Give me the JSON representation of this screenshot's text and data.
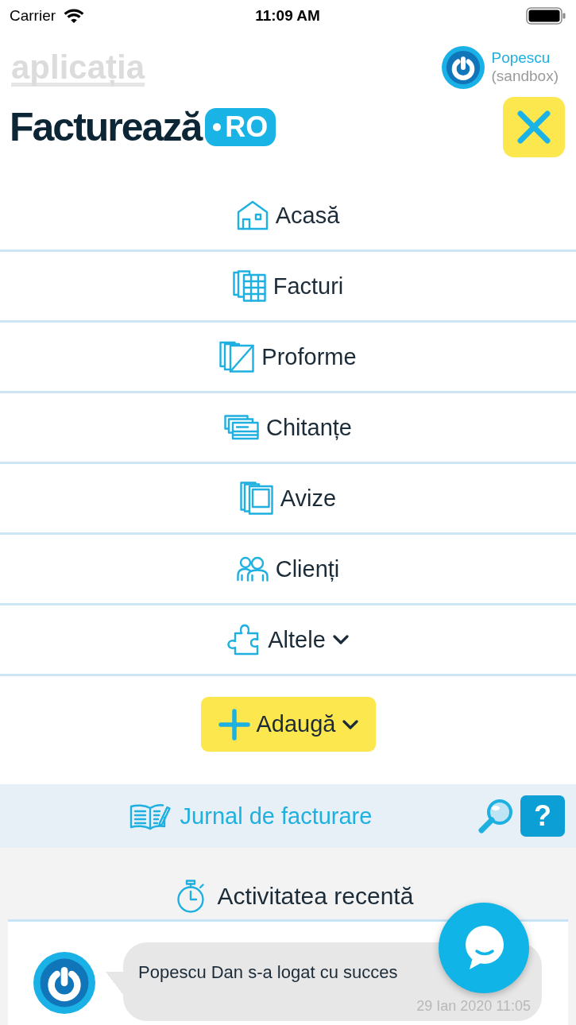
{
  "status_bar": {
    "carrier": "Carrier",
    "time": "11:09 AM"
  },
  "header": {
    "app_logo": "aplicația",
    "user": {
      "name": "Popescu",
      "environment": "(sandbox)"
    },
    "brand_logo": {
      "name": "Facturează",
      "badge": "RO"
    }
  },
  "menu": [
    {
      "label": "Acasă",
      "kind": "link"
    },
    {
      "label": "Facturi",
      "kind": "link"
    },
    {
      "label": "Proforme",
      "kind": "link"
    },
    {
      "label": "Chitanțe",
      "kind": "link"
    },
    {
      "label": "Avize",
      "kind": "link"
    },
    {
      "label": "Clienți",
      "kind": "link"
    },
    {
      "label": "Altele",
      "kind": "dropdown"
    }
  ],
  "add_button": {
    "label": "Adaugă"
  },
  "journal": {
    "title": "Jurnal de facturare",
    "help": "?"
  },
  "recent_activity": {
    "title": "Activitatea recentă",
    "entries": [
      {
        "message": "Popescu Dan s-a logat cu succes",
        "time": "29 Ian 2020 11:05"
      }
    ]
  }
}
